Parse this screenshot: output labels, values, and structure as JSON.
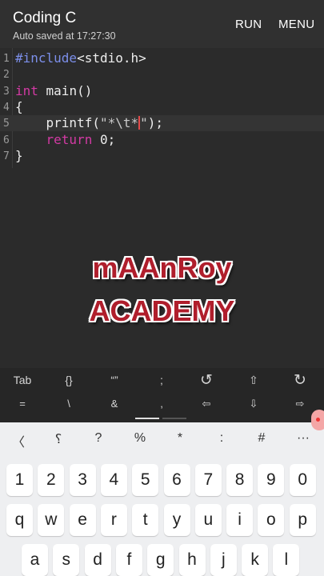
{
  "appbar": {
    "title": "Coding C",
    "subtitle": "Auto saved at 17:27:30",
    "run_label": "RUN",
    "menu_label": "MENU"
  },
  "editor": {
    "lines": [
      {
        "num": "1",
        "parts": [
          [
            "pp",
            "#include"
          ],
          [
            "",
            "<stdio.h>"
          ]
        ]
      },
      {
        "num": "2",
        "parts": []
      },
      {
        "num": "3",
        "parts": [
          [
            "kw",
            "int"
          ],
          [
            "",
            " main()"
          ]
        ]
      },
      {
        "num": "4",
        "parts": [
          [
            "",
            "{"
          ]
        ]
      },
      {
        "num": "5",
        "parts": [
          [
            "",
            "    printf("
          ],
          [
            "str",
            "\"*\\t*"
          ],
          [
            "cursor",
            ""
          ],
          [
            "str",
            "\""
          ],
          [
            "",
            ");"
          ]
        ]
      },
      {
        "num": "6",
        "parts": [
          [
            "",
            "    "
          ],
          [
            "kw",
            "return"
          ],
          [
            "",
            " 0;"
          ]
        ]
      },
      {
        "num": "7",
        "parts": [
          [
            "",
            "}"
          ]
        ]
      }
    ],
    "current_line": 5
  },
  "watermark": {
    "line1": "mAAnRoy",
    "line2": "ACADEMY"
  },
  "extra_keys": {
    "row1": [
      "Tab",
      "{}",
      "“”",
      ";",
      "↺",
      "⇧",
      "↻"
    ],
    "row2": [
      "=",
      "\\",
      "&",
      ",",
      "⇦",
      "⇩",
      "⇨"
    ]
  },
  "keyboard": {
    "top": [
      "〈",
      "؟",
      "?",
      "%",
      "*",
      ":",
      "#",
      "···"
    ],
    "row1": [
      "1",
      "2",
      "3",
      "4",
      "5",
      "6",
      "7",
      "8",
      "9",
      "0"
    ],
    "row2": [
      "q",
      "w",
      "e",
      "r",
      "t",
      "y",
      "u",
      "i",
      "o",
      "p"
    ],
    "row3": [
      "a",
      "s",
      "d",
      "f",
      "g",
      "h",
      "j",
      "k",
      "l"
    ]
  },
  "colors": {
    "keyword": "#d33aa4",
    "preprocessor": "#7c8fea",
    "cursor": "#e24a4a",
    "watermark": "#b01e2c"
  }
}
